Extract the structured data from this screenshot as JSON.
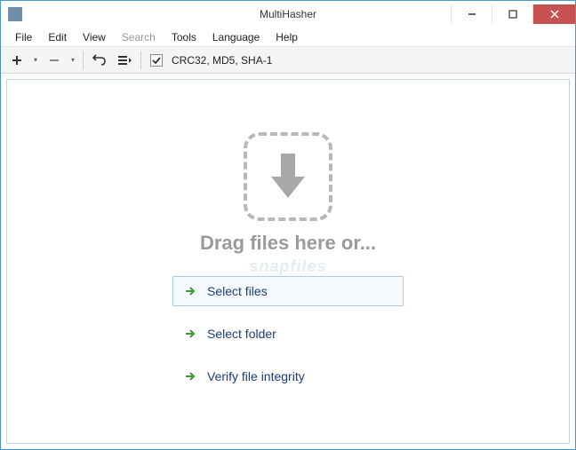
{
  "window": {
    "title": "MultiHasher"
  },
  "menu": {
    "file": "File",
    "edit": "Edit",
    "view": "View",
    "search": "Search",
    "tools": "Tools",
    "language": "Language",
    "help": "Help"
  },
  "toolbar": {
    "hash_label": "CRC32, MD5, SHA-1"
  },
  "content": {
    "drop_text": "Drag files here or...",
    "watermark": "snapfiles",
    "actions": {
      "select_files": "Select files",
      "select_folder": "Select folder",
      "verify": "Verify file integrity"
    }
  }
}
